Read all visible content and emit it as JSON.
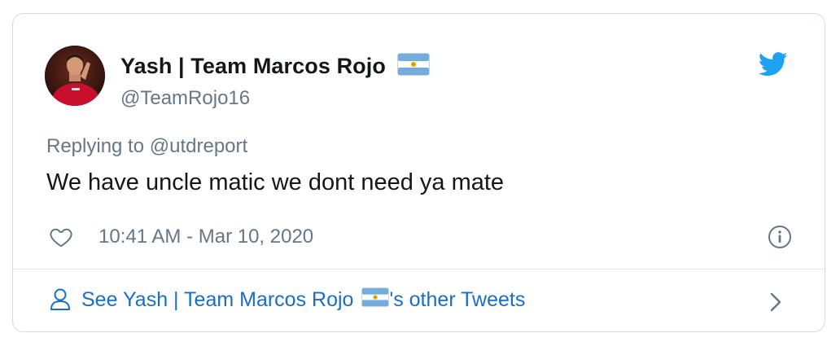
{
  "tweet": {
    "author": {
      "display_name": "Yash | Team Marcos Rojo",
      "handle": "@TeamRojo16",
      "avatar_alt": "profile photo",
      "flag": "argentina-flag"
    },
    "reply_prefix": "Replying to",
    "reply_to": "@utdreport",
    "text": "We have uncle matic we dont need ya mate",
    "timestamp": "10:41 AM - Mar 10, 2020"
  },
  "footer": {
    "link_prefix": "See Yash | Team Marcos Rojo",
    "link_suffix": "'s other Tweets"
  },
  "colors": {
    "twitter_blue": "#1da1f2",
    "link_blue": "#1b6ec2",
    "text_primary": "#14171a",
    "text_secondary": "#657786",
    "border": "#d5dbe0",
    "flag_blue": "#74acdf",
    "flag_sun": "#f6b40e"
  },
  "icons": {
    "brand": "twitter-bird-icon",
    "like": "heart-icon",
    "info": "info-icon",
    "profile": "user-icon",
    "more": "chevron-right-icon"
  }
}
